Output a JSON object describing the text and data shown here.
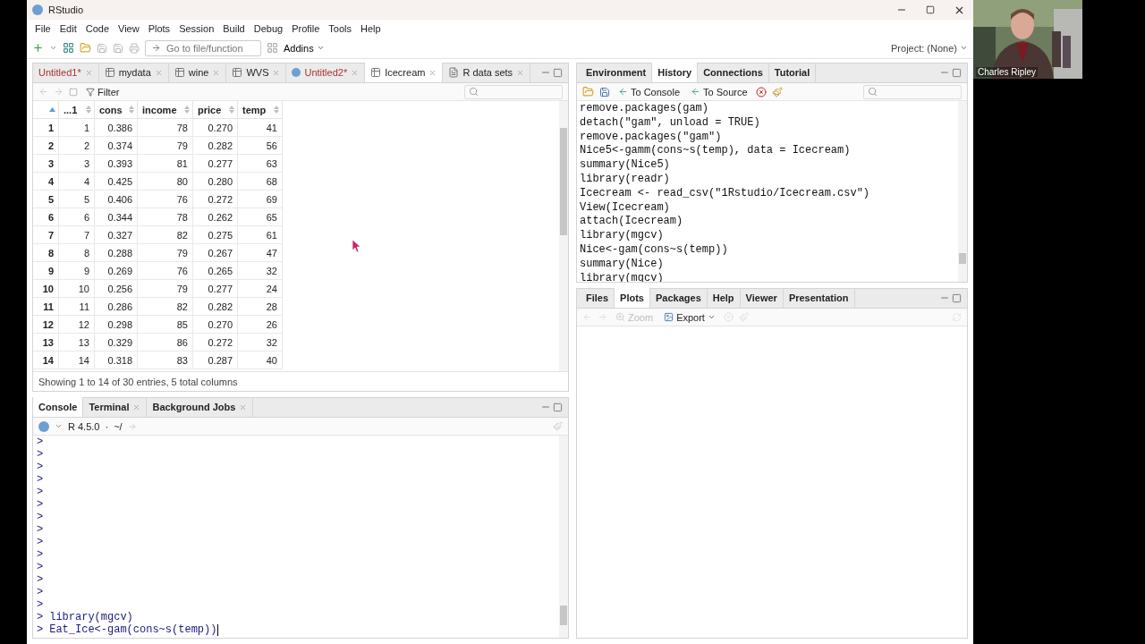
{
  "window": {
    "title": "RStudio"
  },
  "menu": [
    "File",
    "Edit",
    "Code",
    "View",
    "Plots",
    "Session",
    "Build",
    "Debug",
    "Profile",
    "Tools",
    "Help"
  ],
  "toolbar": {
    "goto_placeholder": "Go to file/function",
    "addins": "Addins",
    "project": "Project: (None)"
  },
  "source_pane": {
    "tabs": [
      {
        "label": "Untitled1*",
        "modified": true,
        "selected": false
      },
      {
        "label": "mydata",
        "kind": "data",
        "modified": false,
        "selected": false
      },
      {
        "label": "wine",
        "kind": "data",
        "modified": false,
        "selected": false
      },
      {
        "label": "WVS",
        "kind": "data",
        "modified": false,
        "selected": false
      },
      {
        "label": "Untitled2*",
        "kind": "script",
        "modified": true,
        "selected": false
      },
      {
        "label": "Icecream",
        "kind": "data",
        "modified": false,
        "selected": true
      },
      {
        "label": "R data sets",
        "kind": "doc",
        "modified": false,
        "selected": false
      }
    ],
    "filter": "Filter",
    "table": {
      "columns": [
        "...1",
        "cons",
        "income",
        "price",
        "temp"
      ],
      "rows": [
        {
          "label": "1",
          "cells": [
            "1",
            "0.386",
            "78",
            "0.270",
            "41"
          ]
        },
        {
          "label": "2",
          "cells": [
            "2",
            "0.374",
            "79",
            "0.282",
            "56"
          ]
        },
        {
          "label": "3",
          "cells": [
            "3",
            "0.393",
            "81",
            "0.277",
            "63"
          ]
        },
        {
          "label": "4",
          "cells": [
            "4",
            "0.425",
            "80",
            "0.280",
            "68"
          ]
        },
        {
          "label": "5",
          "cells": [
            "5",
            "0.406",
            "76",
            "0.272",
            "69"
          ]
        },
        {
          "label": "6",
          "cells": [
            "6",
            "0.344",
            "78",
            "0.262",
            "65"
          ]
        },
        {
          "label": "7",
          "cells": [
            "7",
            "0.327",
            "82",
            "0.275",
            "61"
          ]
        },
        {
          "label": "8",
          "cells": [
            "8",
            "0.288",
            "79",
            "0.267",
            "47"
          ]
        },
        {
          "label": "9",
          "cells": [
            "9",
            "0.269",
            "76",
            "0.265",
            "32"
          ]
        },
        {
          "label": "10",
          "cells": [
            "10",
            "0.256",
            "79",
            "0.277",
            "24"
          ]
        },
        {
          "label": "11",
          "cells": [
            "11",
            "0.286",
            "82",
            "0.282",
            "28"
          ]
        },
        {
          "label": "12",
          "cells": [
            "12",
            "0.298",
            "85",
            "0.270",
            "26"
          ]
        },
        {
          "label": "13",
          "cells": [
            "13",
            "0.329",
            "86",
            "0.272",
            "32"
          ]
        },
        {
          "label": "14",
          "cells": [
            "14",
            "0.318",
            "83",
            "0.287",
            "40"
          ]
        }
      ]
    },
    "footer": "Showing 1 to 14 of 30 entries, 5 total columns"
  },
  "console_pane": {
    "tabs": [
      {
        "label": "Console",
        "selected": true,
        "closable": false
      },
      {
        "label": "Terminal",
        "selected": false,
        "closable": true
      },
      {
        "label": "Background Jobs",
        "selected": false,
        "closable": true
      }
    ],
    "version": "R 4.5.0",
    "separator": "·",
    "dir": "~/",
    "lines": [
      {
        "prompt": ">"
      },
      {
        "prompt": ">"
      },
      {
        "prompt": ">"
      },
      {
        "prompt": ">"
      },
      {
        "prompt": ">"
      },
      {
        "prompt": ">"
      },
      {
        "prompt": ">"
      },
      {
        "prompt": ">"
      },
      {
        "prompt": ">"
      },
      {
        "prompt": ">"
      },
      {
        "prompt": ">"
      },
      {
        "prompt": ">"
      },
      {
        "prompt": ">"
      },
      {
        "prompt": ">"
      },
      {
        "prompt": ">",
        "code": "library(mgcv)"
      },
      {
        "prompt": ">",
        "code": "Eat_Ice<-gam(cons~s(temp))"
      }
    ]
  },
  "environment_pane": {
    "tabs": [
      {
        "label": "Environment",
        "selected": false
      },
      {
        "label": "History",
        "selected": true
      },
      {
        "label": "Connections",
        "selected": false
      },
      {
        "label": "Tutorial",
        "selected": false
      }
    ],
    "buttons": [
      "To Console",
      "To Source"
    ],
    "history": [
      "remove.packages(gam)",
      "detach(\"gam\", unload = TRUE)",
      "remove.packages(\"gam\")",
      "Nice5<-gamm(cons~s(temp), data = Icecream)",
      "summary(Nice5)",
      "library(readr)",
      "Icecream <- read_csv(\"1Rstudio/Icecream.csv\")",
      "View(Icecream)",
      "attach(Icecream)",
      "library(mgcv)",
      "Nice<-gam(cons~s(temp))",
      "summary(Nice)",
      "library(mgcv)"
    ]
  },
  "plots_pane": {
    "tabs": [
      {
        "label": "Files",
        "selected": false
      },
      {
        "label": "Plots",
        "selected": true
      },
      {
        "label": "Packages",
        "selected": false
      },
      {
        "label": "Help",
        "selected": false
      },
      {
        "label": "Viewer",
        "selected": false
      },
      {
        "label": "Presentation",
        "selected": false
      }
    ],
    "zoom": {
      "label": "Zoom",
      "disabled": true
    },
    "export": {
      "label": "Export",
      "disabled": false
    }
  },
  "webcam": {
    "name": "Charles Ripley"
  }
}
